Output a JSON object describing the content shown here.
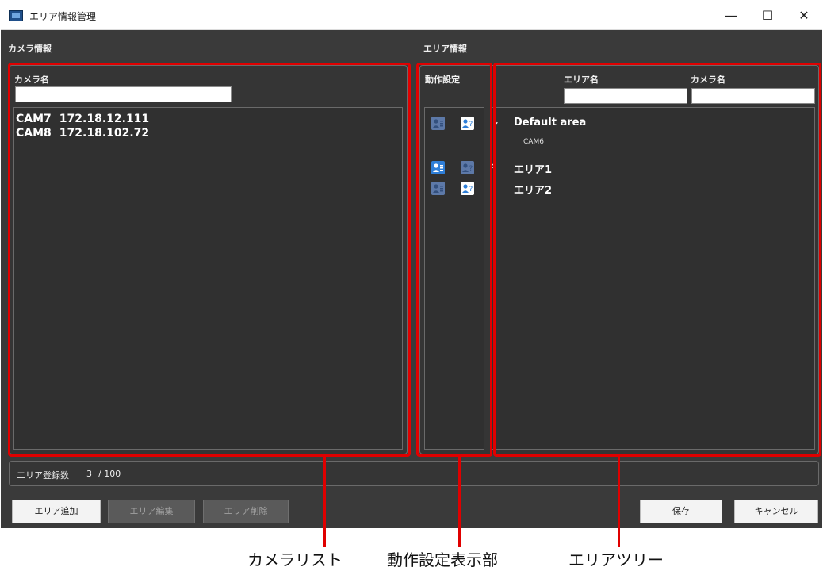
{
  "window": {
    "title": "エリア情報管理",
    "controls": {
      "minimize": "—",
      "maximize": "☐",
      "close": "✕"
    }
  },
  "camera_info": {
    "section_label": "カメラ情報",
    "camera_name_label": "カメラ名",
    "camera_name_value": "",
    "cameras": [
      {
        "name": "CAM7",
        "ip": "172.18.12.111"
      },
      {
        "name": "CAM8",
        "ip": "172.18.102.72"
      }
    ]
  },
  "area_info": {
    "section_label": "エリア情報",
    "operation_settings_label": "動作設定",
    "area_name_label": "エリア名",
    "area_camera_name_label": "カメラ名",
    "area_name_filter": "",
    "camera_name_filter": "",
    "tree": [
      {
        "label": "Default area",
        "expander": "⌄",
        "icon1_active": false,
        "icon2_active": true,
        "children": [
          {
            "label": "CAM6"
          }
        ]
      },
      {
        "label": "エリア1",
        "expander": "›",
        "icon1_active": true,
        "icon2_active": false
      },
      {
        "label": "エリア2",
        "expander": "",
        "icon1_active": false,
        "icon2_active": true
      }
    ]
  },
  "status": {
    "label": "エリア登録数",
    "count": "3",
    "max": "/ 100"
  },
  "buttons": {
    "add_area": "エリア追加",
    "edit_area": "エリア編集",
    "delete_area": "エリア削除",
    "save": "保存",
    "cancel": "キャンセル"
  },
  "annotations": {
    "camera_list": "カメラリスト",
    "operation_display": "動作設定表示部",
    "area_tree": "エリアツリー",
    "callout_color": "#e00000"
  }
}
